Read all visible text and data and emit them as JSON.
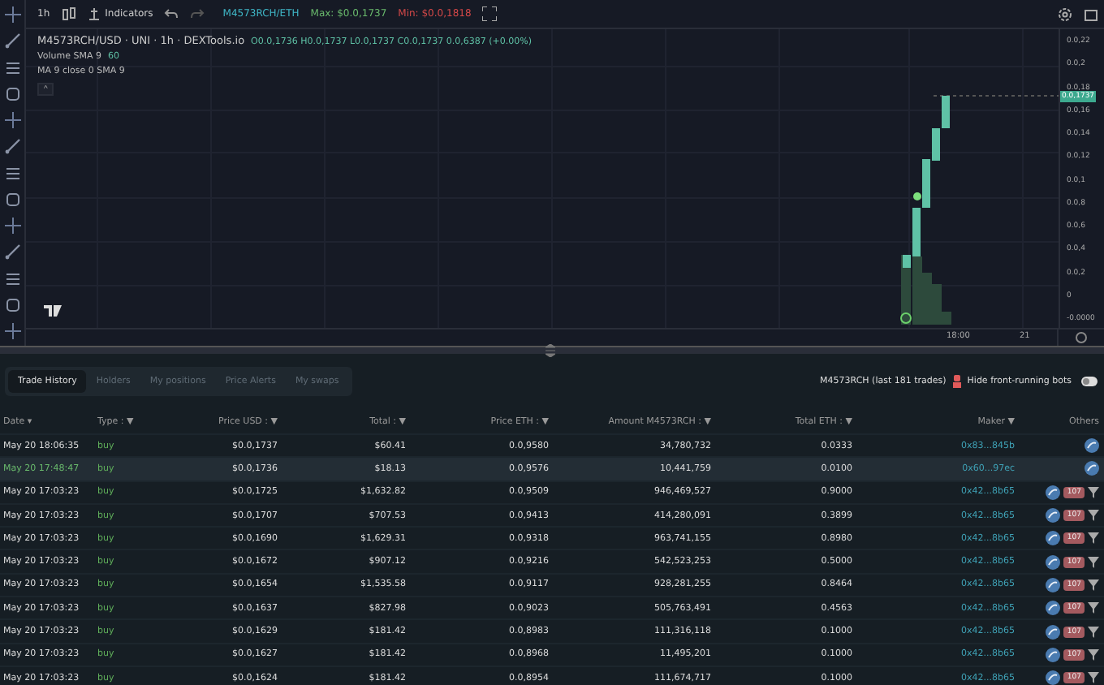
{
  "toolbar": {
    "interval": "1h",
    "indicators": "Indicators",
    "pair": "M4573RCH/ETH",
    "max": "Max: $0.0,1737",
    "min": "Min: $0.0,1818"
  },
  "legend": {
    "title": "M4573RCH/USD · UNI · 1h · DEXTools.io",
    "ohlc": "O0.0,1736 H0.0,1737 L0.0,1737 C0.0,1737 0.0,6387 (+0.00%)",
    "volume_label": "Volume SMA 9",
    "volume_value": "60",
    "ma": "MA 9 close 0 SMA 9",
    "collapse": "^"
  },
  "price_axis": {
    "labels": [
      "0.0,22",
      "0.0,2",
      "0.0,18",
      "0.0,16",
      "0.0,14",
      "0.0,12",
      "0.0,1",
      "0.0,8",
      "0.0,6",
      "0.0,4",
      "0.0,2",
      "0",
      "-0.0000"
    ],
    "current": "0.0,1737"
  },
  "time_axis": [
    "18:00",
    "21"
  ],
  "tabs": [
    {
      "label": "Trade History",
      "selected": true
    },
    {
      "label": "Holders",
      "selected": false
    },
    {
      "label": "My positions",
      "selected": false
    },
    {
      "label": "Price Alerts",
      "selected": false
    },
    {
      "label": "My swaps",
      "selected": false
    }
  ],
  "trades_info": "M4573RCH (last 181 trades)",
  "hide_bots": {
    "label": "Hide front-running bots",
    "on": false
  },
  "table": {
    "columns": [
      "Date ▾",
      "Type : ▼",
      "Price USD : ▼",
      "Total : ▼",
      "Price ETH : ▼",
      "Amount M4573RCH : ▼",
      "Total ETH : ▼",
      "Maker ▼",
      "Others"
    ],
    "rows": [
      {
        "date": "May 20 18:06:35",
        "type": "buy",
        "price_usd": "$0.0,1737",
        "total": "$60.41",
        "price_eth": "0.0,9580",
        "amount": "34,780,732",
        "total_eth": "0.0333",
        "maker": "0x83...845b",
        "selected": false
      },
      {
        "date": "May 20 17:48:47",
        "type": "buy",
        "price_usd": "$0.0,1736",
        "total": "$18.13",
        "price_eth": "0.0,9576",
        "amount": "10,441,759",
        "total_eth": "0.0100",
        "maker": "0x60...97ec",
        "selected": true
      },
      {
        "date": "May 20 17:03:23",
        "type": "buy",
        "price_usd": "$0.0,1725",
        "total": "$1,632.82",
        "price_eth": "0.0,9509",
        "amount": "946,469,527",
        "total_eth": "0.9000",
        "maker": "0x42...8b65",
        "badge": "107",
        "selected": false
      },
      {
        "date": "May 20 17:03:23",
        "type": "buy",
        "price_usd": "$0.0,1707",
        "total": "$707.53",
        "price_eth": "0.0,9413",
        "amount": "414,280,091",
        "total_eth": "0.3899",
        "maker": "0x42...8b65",
        "badge": "107",
        "selected": false
      },
      {
        "date": "May 20 17:03:23",
        "type": "buy",
        "price_usd": "$0.0,1690",
        "total": "$1,629.31",
        "price_eth": "0.0,9318",
        "amount": "963,741,155",
        "total_eth": "0.8980",
        "maker": "0x42...8b65",
        "badge": "107",
        "selected": false
      },
      {
        "date": "May 20 17:03:23",
        "type": "buy",
        "price_usd": "$0.0,1672",
        "total": "$907.12",
        "price_eth": "0.0,9216",
        "amount": "542,523,253",
        "total_eth": "0.5000",
        "maker": "0x42...8b65",
        "badge": "107",
        "selected": false
      },
      {
        "date": "May 20 17:03:23",
        "type": "buy",
        "price_usd": "$0.0,1654",
        "total": "$1,535.58",
        "price_eth": "0.0,9117",
        "amount": "928,281,255",
        "total_eth": "0.8464",
        "maker": "0x42...8b65",
        "badge": "107",
        "selected": false
      },
      {
        "date": "May 20 17:03:23",
        "type": "buy",
        "price_usd": "$0.0,1637",
        "total": "$827.98",
        "price_eth": "0.0,9023",
        "amount": "505,763,491",
        "total_eth": "0.4563",
        "maker": "0x42...8b65",
        "badge": "107",
        "selected": false
      },
      {
        "date": "May 20 17:03:23",
        "type": "buy",
        "price_usd": "$0.0,1629",
        "total": "$181.42",
        "price_eth": "0.0,8983",
        "amount": "111,316,118",
        "total_eth": "0.1000",
        "maker": "0x42...8b65",
        "badge": "107",
        "selected": false
      },
      {
        "date": "May 20 17:03:23",
        "type": "buy",
        "price_usd": "$0.0,1627",
        "total": "$181.42",
        "price_eth": "0.0,8968",
        "amount": "11,495,201",
        "total_eth": "0.1000",
        "maker": "0x42...8b65",
        "badge": "107",
        "selected": false
      },
      {
        "date": "May 20 17:03:23",
        "type": "buy",
        "price_usd": "$0.0,1624",
        "total": "$181.42",
        "price_eth": "0.0,8954",
        "amount": "111,674,717",
        "total_eth": "0.1000",
        "maker": "0x42...8b65",
        "badge": "107",
        "selected": false
      }
    ]
  }
}
